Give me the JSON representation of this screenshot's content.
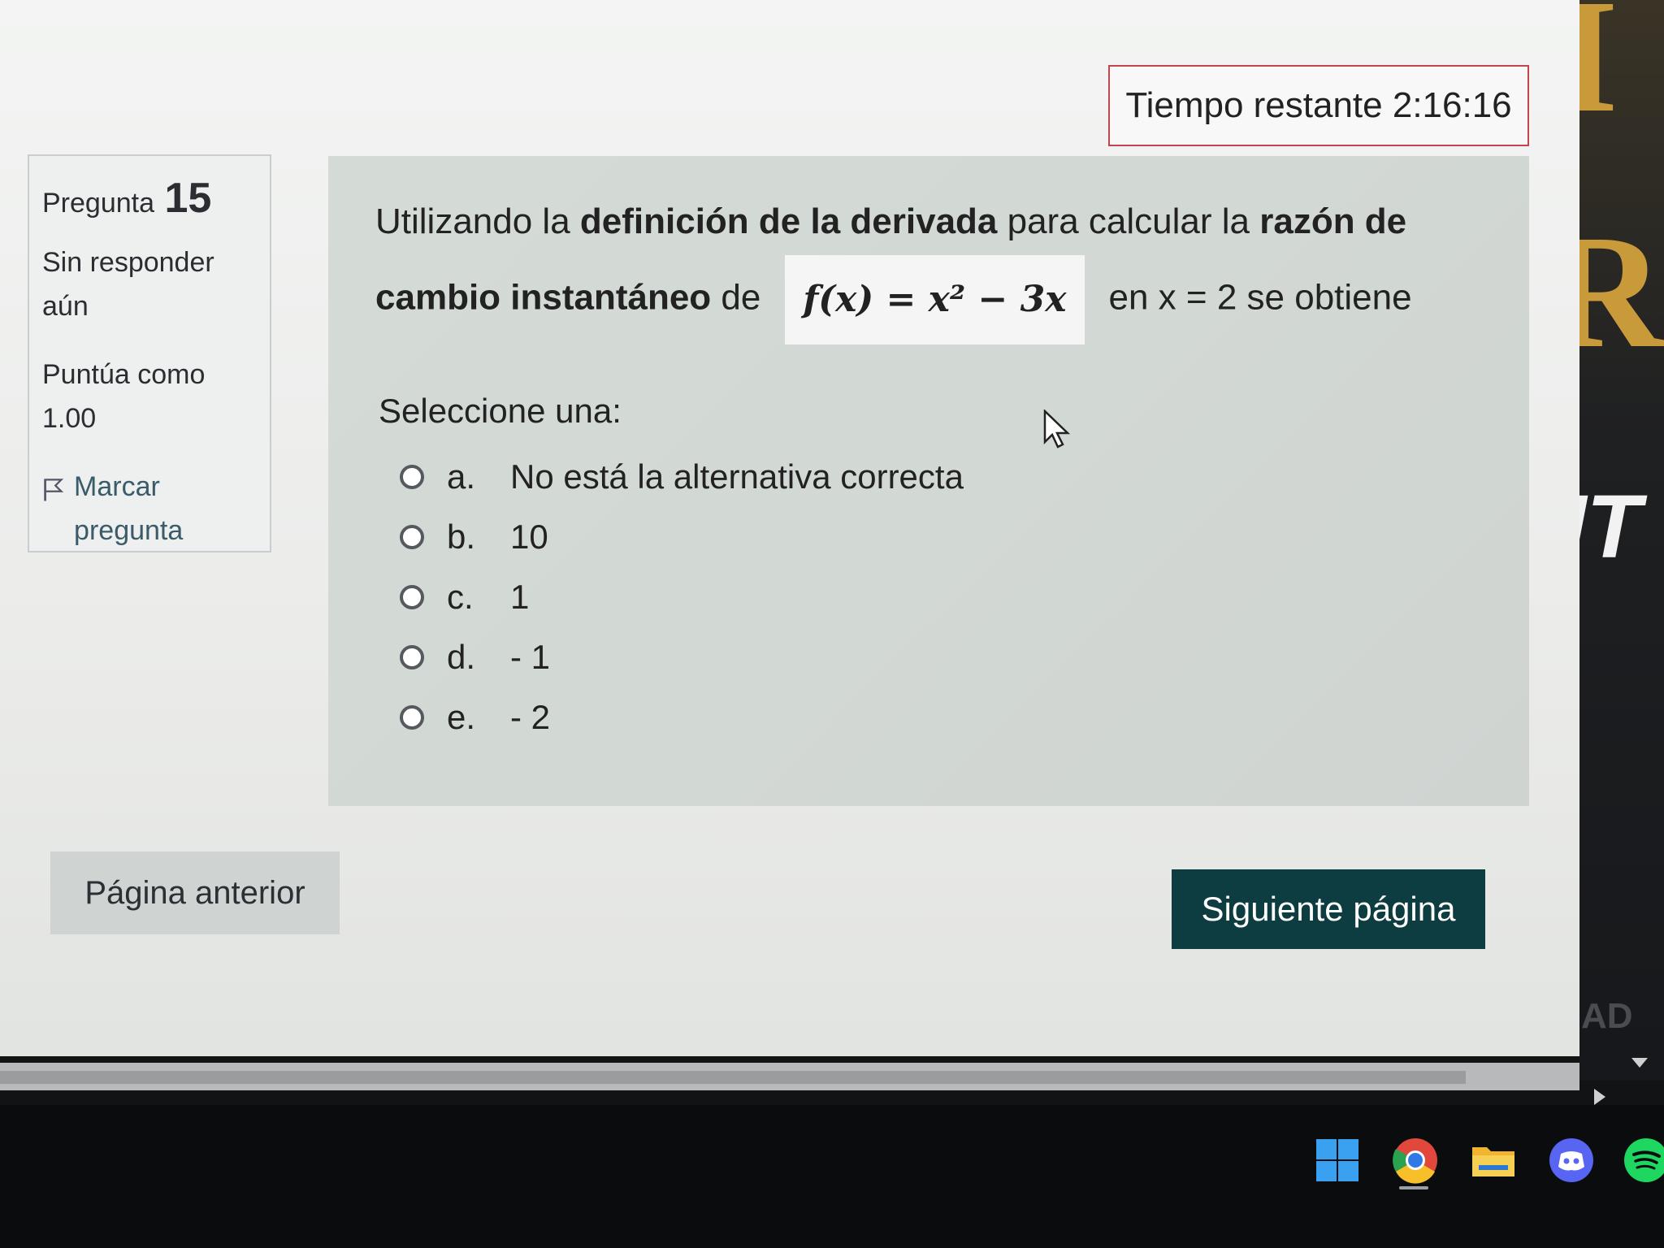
{
  "timer": {
    "label": "Tiempo restante 2:16:16"
  },
  "info": {
    "question_label": "Pregunta",
    "question_number": "15",
    "status": "Sin responder aún",
    "grade": "Puntúa como 1.00",
    "flag_label": "Marcar pregunta"
  },
  "question": {
    "part1": "Utilizando la ",
    "bold1": "definición de la derivada",
    "part2": " para calcular la ",
    "bold2": "razón de cambio instantáneo",
    "part3": " de",
    "formula": "f(x) = x² − 3x",
    "part4": "en   x = 2  se obtiene"
  },
  "select_label": "Seleccione una:",
  "options": [
    {
      "letter": "a.",
      "text": "No está la alternativa correcta"
    },
    {
      "letter": "b.",
      "text": "10"
    },
    {
      "letter": "c.",
      "text": "1"
    },
    {
      "letter": "d.",
      "text": "- 1"
    },
    {
      "letter": "e.",
      "text": "- 2"
    }
  ],
  "buttons": {
    "prev": "Página anterior",
    "next": "Siguiente página"
  },
  "colors": {
    "next_button": "#0d3d40",
    "timer_border": "#c1474e"
  },
  "taskbar_icons": [
    "windows-start-icon",
    "chrome-icon",
    "file-explorer-icon",
    "discord-icon",
    "spotify-icon"
  ]
}
